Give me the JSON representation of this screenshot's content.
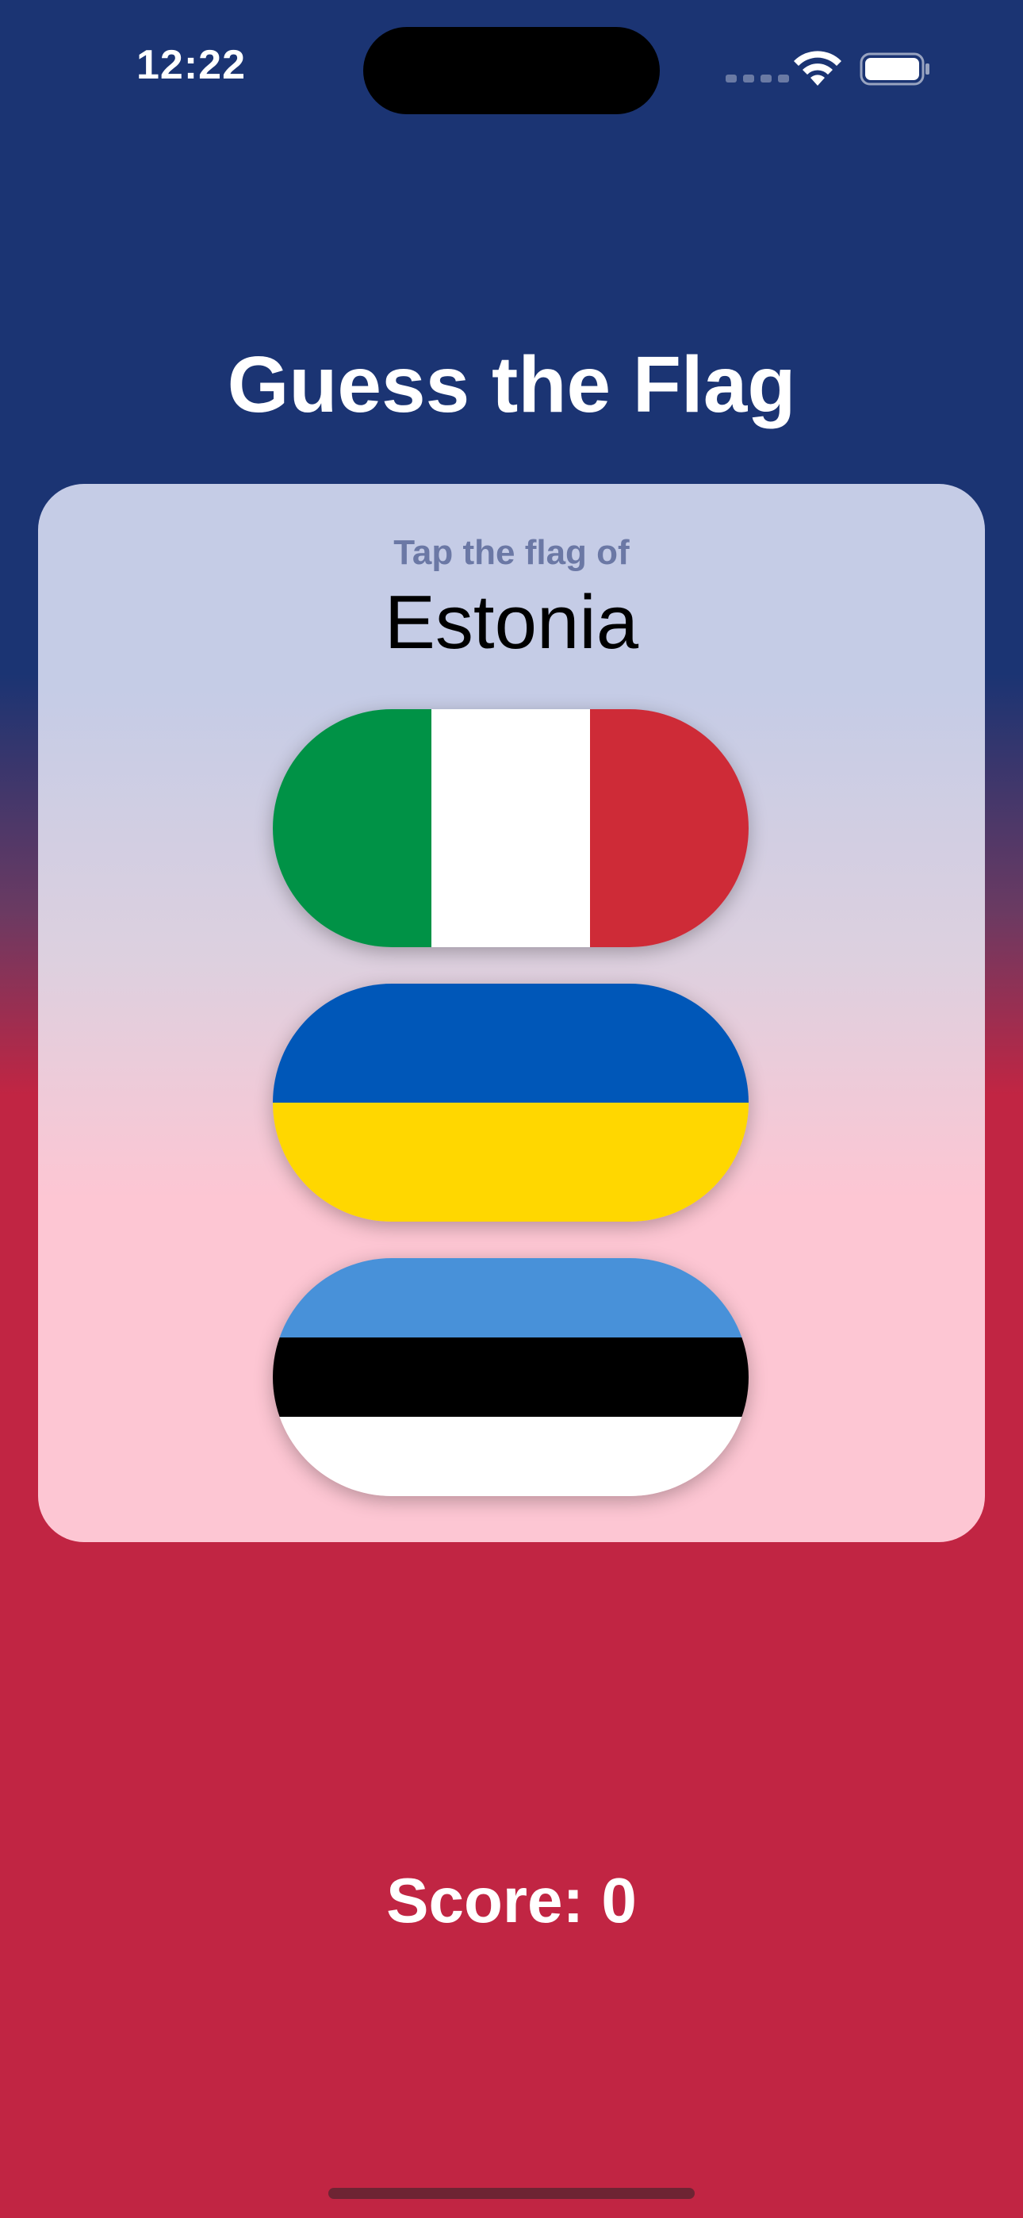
{
  "status_bar": {
    "time": "12:22",
    "icons": [
      "cellular-signal-icon",
      "wifi-icon",
      "battery-icon"
    ]
  },
  "app": {
    "title": "Guess the Flag"
  },
  "question": {
    "prompt": "Tap the flag of",
    "country": "Estonia"
  },
  "flags": [
    {
      "country": "Italy",
      "stripes": "vertical",
      "colors": [
        "#009246",
        "#ffffff",
        "#ce2b37"
      ]
    },
    {
      "country": "Ukraine",
      "stripes": "horizontal",
      "colors": [
        "#0057b8",
        "#ffd700"
      ]
    },
    {
      "country": "Estonia",
      "stripes": "horizontal",
      "colors": [
        "#4891d9",
        "#000000",
        "#ffffff"
      ]
    }
  ],
  "score": {
    "text": "Score: 0"
  },
  "colors": {
    "top_background": "#1b3473",
    "bottom_background": "#c12543",
    "prompt_text": "#6b78a5"
  }
}
